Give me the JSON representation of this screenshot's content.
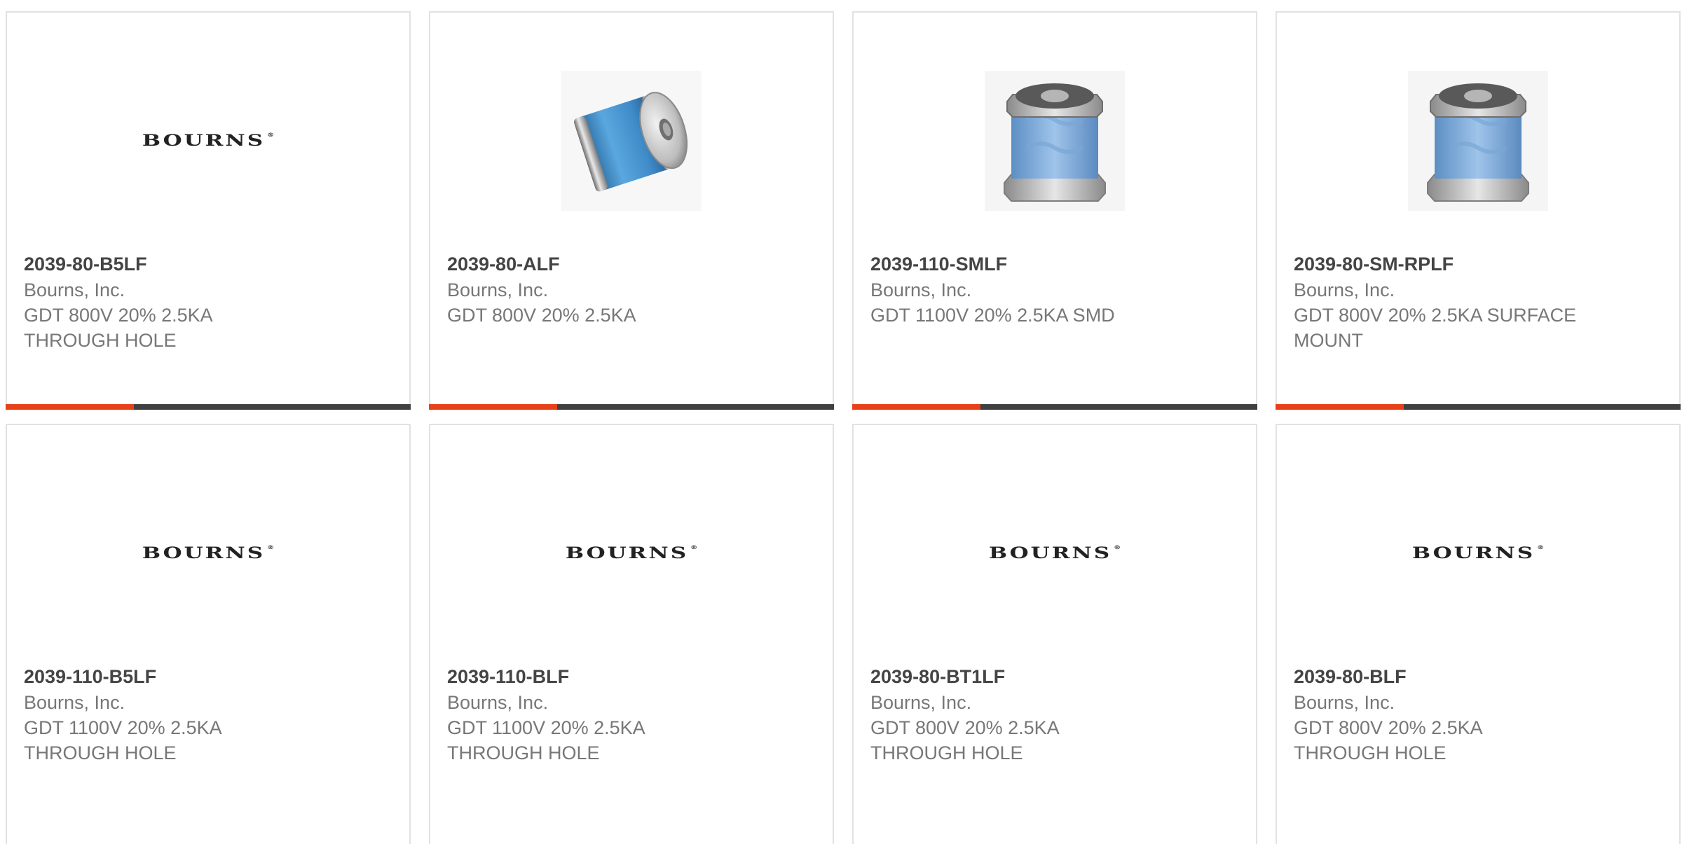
{
  "brand": {
    "logo_text": "BOURNS",
    "logo_mark": "®",
    "accent_color": "#e8411a",
    "bar_color": "#404040"
  },
  "products": [
    {
      "part_number": "2039-80-B5LF",
      "manufacturer": "Bourns, Inc.",
      "description": "GDT 800V 20% 2.5KA\nTHROUGH HOLE",
      "image": "bourns-logo"
    },
    {
      "part_number": "2039-80-ALF",
      "manufacturer": "Bourns, Inc.",
      "description": "GDT 800V 20% 2.5KA",
      "image": "gdt-cylinder-photo"
    },
    {
      "part_number": "2039-110-SMLF",
      "manufacturer": "Bourns, Inc.",
      "description": "GDT 1100V 20% 2.5KA SMD",
      "image": "gdt-smd-photo"
    },
    {
      "part_number": "2039-80-SM-RPLF",
      "manufacturer": "Bourns, Inc.",
      "description": "GDT 800V 20% 2.5KA SURFACE\nMOUNT",
      "image": "gdt-smd-photo"
    },
    {
      "part_number": "2039-110-B5LF",
      "manufacturer": "Bourns, Inc.",
      "description": "GDT 1100V 20% 2.5KA\nTHROUGH HOLE",
      "image": "bourns-logo"
    },
    {
      "part_number": "2039-110-BLF",
      "manufacturer": "Bourns, Inc.",
      "description": "GDT 1100V 20% 2.5KA\nTHROUGH HOLE",
      "image": "bourns-logo"
    },
    {
      "part_number": "2039-80-BT1LF",
      "manufacturer": "Bourns, Inc.",
      "description": "GDT 800V 20% 2.5KA\nTHROUGH HOLE",
      "image": "bourns-logo"
    },
    {
      "part_number": "2039-80-BLF",
      "manufacturer": "Bourns, Inc.",
      "description": "GDT 800V 20% 2.5KA\nTHROUGH HOLE",
      "image": "bourns-logo"
    }
  ]
}
